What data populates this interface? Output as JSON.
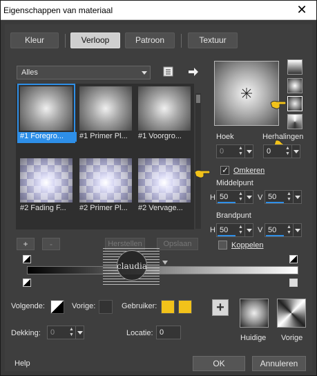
{
  "window": {
    "title": "Eigenschappen van materiaal",
    "close_glyph": "✕"
  },
  "tabs": [
    {
      "label": "Kleur"
    },
    {
      "label": "Verloop"
    },
    {
      "label": "Patroon"
    },
    {
      "label": "Textuur"
    }
  ],
  "library": {
    "filter_selected": "Alles",
    "items": [
      {
        "label": "#1 Foregro..."
      },
      {
        "label": "#1 Primer Pl..."
      },
      {
        "label": "#1 Voorgro..."
      },
      {
        "label": "#2 Fading F..."
      },
      {
        "label": "#2 Primer Pl..."
      },
      {
        "label": "#2 Vervage..."
      }
    ],
    "add_label": "+",
    "remove_label": "-",
    "ghost_left": "Herstellen",
    "ghost_right": "Opslaan"
  },
  "settings": {
    "angle_label": "Hoek",
    "angle_value": "0",
    "repeats_label": "Herhalingen",
    "repeats_value": "0",
    "invert_label": "Omkeren",
    "invert_checked": true,
    "center_label": "Middelpunt",
    "center_h_label": "H",
    "center_h": "50",
    "center_v_label": "V",
    "center_v": "50",
    "focal_label": "Brandpunt",
    "focal_h_label": "H",
    "focal_h": "50",
    "focal_v_label": "V",
    "focal_v": "50",
    "link_label": "Koppelen",
    "link_checked": false
  },
  "stops": {
    "following_label": "Volgende:",
    "previous_label": "Vorige:",
    "user_label": "Gebruiker:",
    "user_color_1": "#f2c21a",
    "user_color_2": "#f2c21a",
    "opacity_label": "Dekking:",
    "opacity_value": "0",
    "location_label": "Locatie:",
    "location_value": "0"
  },
  "previews": {
    "add_button": "+",
    "current_label": "Huidige",
    "previous_label": "Vorige"
  },
  "watermark": {
    "text": "claudia"
  },
  "footer": {
    "help_label": "Help",
    "ok_label": "OK",
    "cancel_label": "Annuleren"
  },
  "colors": {
    "accent": "#2e8fe8",
    "background": "#3e3e3e",
    "pointer_hand": "#f2c21a"
  }
}
